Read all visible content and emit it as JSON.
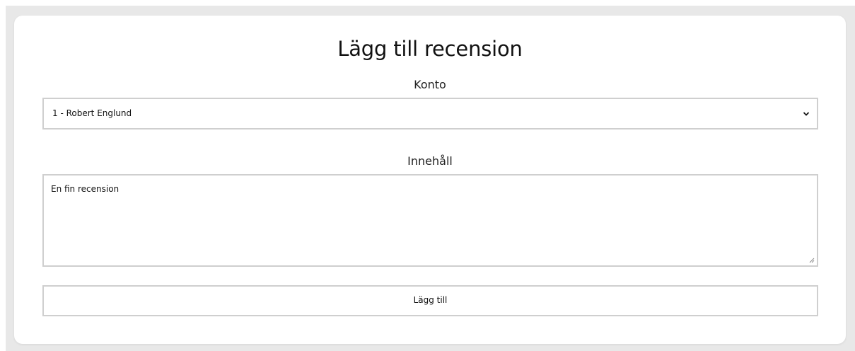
{
  "form": {
    "title": "Lägg till recension",
    "account_label": "Konto",
    "account_selected": "1 - Robert Englund",
    "content_label": "Innehåll",
    "content_value": "En fin recension",
    "submit_label": "Lägg till"
  },
  "icons": {
    "select_chevron": "chevron-down-icon",
    "textarea_resize": "resize-handle-icon"
  },
  "colors": {
    "page_bg": "#e8e8e8",
    "card_bg": "#ffffff",
    "border": "#cfcfcf",
    "text": "#111111"
  }
}
